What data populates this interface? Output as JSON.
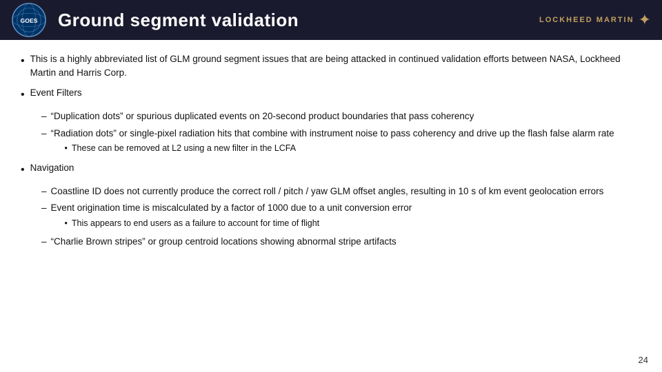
{
  "header": {
    "title": "Ground segment validation",
    "logo_alt": "GOES logo",
    "lockheed_text": "LOCKHEED MARTIN"
  },
  "content": {
    "bullet1": {
      "text": "This is a highly abbreviated list of GLM ground segment issues that are being attacked in continued validation efforts between NASA, Lockheed Martin and Harris Corp."
    },
    "bullet2": {
      "label": "Event Filters",
      "sub1": {
        "text": "“Duplication dots” or spurious duplicated events on 20-second product boundaries that pass coherency"
      },
      "sub2": {
        "text": "“Radiation dots” or single-pixel radiation hits that combine with instrument noise to pass coherency and drive up the flash false alarm rate",
        "subsub1": {
          "text": "These can be removed at L2 using a new filter in the LCFA"
        }
      }
    },
    "bullet3": {
      "label": "Navigation",
      "sub1": {
        "text": "Coastline ID does not currently produce the correct roll / pitch / yaw GLM offset angles, resulting in 10 s of km event geolocation errors"
      },
      "sub2": {
        "text": "Event origination time is miscalculated by a factor of 1000 due to a unit conversion error",
        "subsub1": {
          "text": "This appears to end users as a failure to account for time of flight"
        }
      },
      "sub3": {
        "text": "“Charlie Brown stripes” or group centroid locations showing abnormal stripe artifacts"
      }
    }
  },
  "page_number": "24"
}
